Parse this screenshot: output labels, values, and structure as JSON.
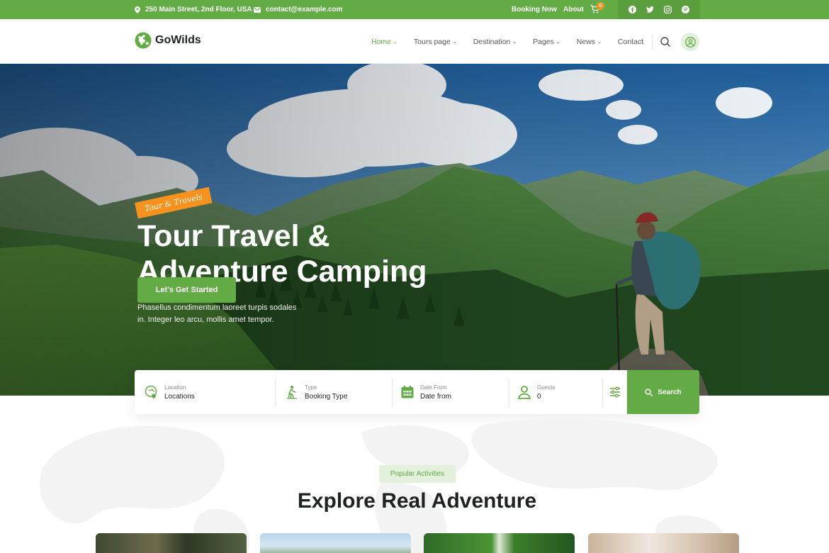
{
  "topbar": {
    "address": "250 Main Street, 2nd Floor, USA",
    "email": "contact@example.com",
    "booking_label": "Booking Now",
    "about_label": "About",
    "cart_count": "0",
    "social_icons": [
      "facebook-icon",
      "twitter-icon",
      "instagram-icon",
      "pinterest-icon"
    ]
  },
  "header": {
    "logo_text": "GoWilds",
    "nav": [
      {
        "label": "Home",
        "active": true,
        "dropdown": true
      },
      {
        "label": "Tours page",
        "dropdown": true
      },
      {
        "label": "Destination",
        "dropdown": true
      },
      {
        "label": "Pages",
        "dropdown": true
      },
      {
        "label": "News",
        "dropdown": true
      },
      {
        "label": "Contact",
        "dropdown": false
      }
    ],
    "caret": "⌄"
  },
  "hero": {
    "tag": "Tour & Travels",
    "title_line1": "Tour Travel &",
    "title_line2": "Adventure Camping",
    "subtitle_line1": "Phasellus condimentum laoreet turpis sodales",
    "subtitle_line2": "in. Integer leo arcu, mollis amet tempor.",
    "cta_label": "Let's Get Started"
  },
  "search_form": {
    "fields": [
      {
        "label": "Location",
        "value": "Locations",
        "icon": "map-pin-icon"
      },
      {
        "label": "Type",
        "value": "Booking Type",
        "icon": "hiker-icon"
      },
      {
        "label": "Date From",
        "value": "Date from",
        "icon": "calendar-icon"
      },
      {
        "label": "Guests",
        "value": "0",
        "icon": "user-icon"
      }
    ],
    "submit_label": "Search"
  },
  "section": {
    "badge": "Popular Activities",
    "title": "Explore Real Adventure"
  },
  "colors": {
    "brand_green": "#63ab45",
    "accent_orange": "#f7921e",
    "dark_text": "#1d231f"
  }
}
